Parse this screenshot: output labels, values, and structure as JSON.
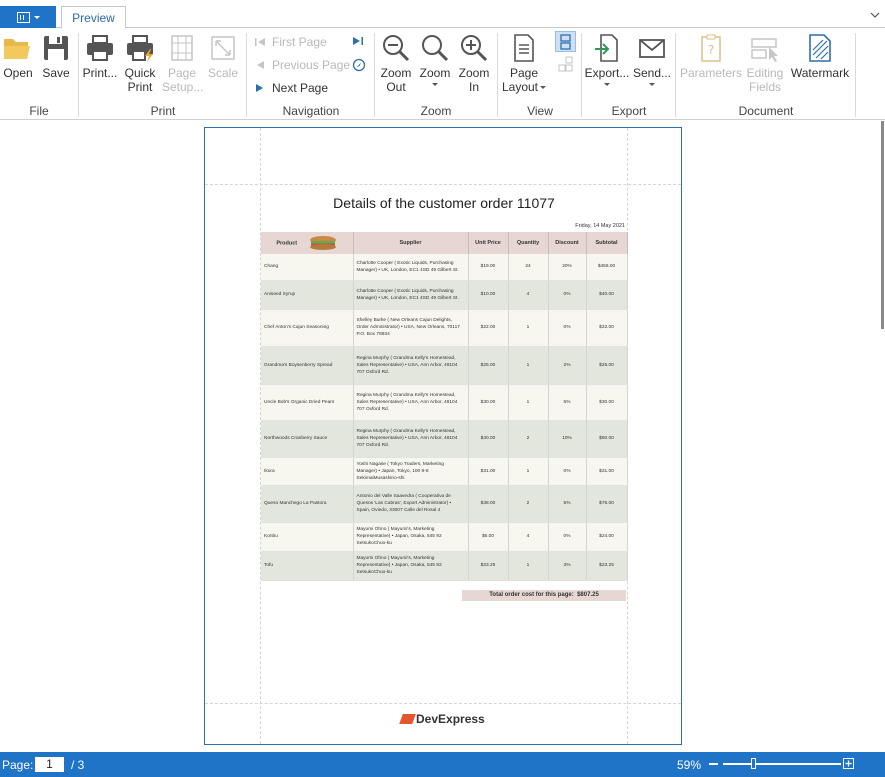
{
  "tabs": {
    "active": "Preview"
  },
  "colors": {
    "accent": "#1f74c7",
    "header_row": "#e6d7d3",
    "row_light": "#f7f7f0",
    "row_dark": "#e2e6dc"
  },
  "ribbon": {
    "groups": {
      "file": "File",
      "print": "Print",
      "navigation": "Navigation",
      "zoom": "Zoom",
      "view": "View",
      "export": "Export",
      "document": "Document"
    },
    "buttons": {
      "open": "Open",
      "save": "Save",
      "print": "Print...",
      "quick_print_1": "Quick",
      "quick_print_2": "Print",
      "page_setup_1": "Page",
      "page_setup_2": "Setup...",
      "scale": "Scale",
      "first_page": "First Page",
      "previous_page": "Previous Page",
      "next_page": "Next Page",
      "zoom_out_1": "Zoom",
      "zoom_out_2": "Out",
      "zoom": "Zoom",
      "zoom_in_1": "Zoom",
      "zoom_in_2": "In",
      "page_layout_1": "Page",
      "page_layout_2": "Layout",
      "export": "Export...",
      "send": "Send...",
      "parameters": "Parameters",
      "editing_fields_1": "Editing",
      "editing_fields_2": "Fields",
      "watermark": "Watermark"
    }
  },
  "report": {
    "title": "Details of the customer order",
    "order_number": "11077",
    "date": "Friday, 14 May 2021",
    "columns": [
      "Product",
      "Supplier",
      "Unit Price",
      "Quantity",
      "Discount",
      "Subtotal"
    ],
    "rows": [
      [
        "Chang",
        "Charlotte Cooper ( Exotic Liquids, Purchasing Manager) • UK, London, EC1 4SD 49 Gilbert St.",
        "$19.00",
        "24",
        "20%",
        "$456.00"
      ],
      [
        "Aniseed Syrup",
        "Charlotte Cooper ( Exotic Liquids, Purchasing Manager) • UK, London, EC1 4SD 49 Gilbert St.",
        "$10.00",
        "4",
        "0%",
        "$40.00"
      ],
      [
        "Chef Anton's Cajun Seasoning",
        "Shelley Burke ( New Orleans Cajun Delights, Order Administrator) • USA, New Orleans, 70117 P.O. Box 78934",
        "$22.00",
        "1",
        "0%",
        "$22.00"
      ],
      [
        "Grandma's Boysenberry Spread",
        "Regina Murphy ( Grandma Kelly's Homestead, Sales Representative) • USA, Ann Arbor, 48104 707 Oxford Rd.",
        "$25.00",
        "1",
        "2%",
        "$25.00"
      ],
      [
        "Uncle Bob's Organic Dried Pears",
        "Regina Murphy ( Grandma Kelly's Homestead, Sales Representative) • USA, Ann Arbor, 48104 707 Oxford Rd.",
        "$30.00",
        "1",
        "5%",
        "$30.00"
      ],
      [
        "Northwoods Cranberry Sauce",
        "Regina Murphy ( Grandma Kelly's Homestead, Sales Representative) • USA, Ann Arbor, 48104 707 Oxford Rd.",
        "$40.00",
        "2",
        "10%",
        "$80.00"
      ],
      [
        "Ikura",
        "Yoshi Nagase ( Tokyo Traders, Marketing Manager) • Japan, Tokyo, 100 9-8 SekimaiMusashino-shi",
        "$31.00",
        "1",
        "0%",
        "$31.00"
      ],
      [
        "Queso Manchego La Pastora",
        "Antonio del Valle Saavedra ( Cooperativa de Quesos 'Las Cabras', Export Administrator) • Spain, Oviedo, 33007 Calle del Rosal 4",
        "$38.00",
        "2",
        "5%",
        "$76.00"
      ],
      [
        "Konbu",
        "Mayumi Ohno ( Mayumi's, Marketing Representative) • Japan, Osaka, 545 92 SetsukoChuo-ku",
        "$6.00",
        "4",
        "0%",
        "$24.00"
      ],
      [
        "Tofu",
        "Mayumi Ohno ( Mayumi's, Marketing Representative) • Japan, Osaka, 545 92 SetsukoChuo-ku",
        "$23.25",
        "1",
        "3%",
        "$23.25"
      ]
    ],
    "total_label": "Total order cost for this page:",
    "total_value": "$807.25",
    "logo_text": "DevExpress"
  },
  "status": {
    "page_label": "Page:",
    "page_value": "1",
    "page_total": "/ 3",
    "zoom": "59%"
  },
  "icons": [
    "app-menu-icon",
    "open-folder-icon",
    "save-disk-icon",
    "printer-icon",
    "quick-print-icon",
    "page-setup-icon",
    "scale-icon",
    "first-page-icon",
    "previous-page-icon",
    "next-page-icon",
    "last-page-icon",
    "find-icon",
    "zoom-out-icon",
    "zoom-icon",
    "zoom-in-icon",
    "page-layout-icon",
    "multi-page-icon",
    "export-icon",
    "send-envelope-icon",
    "parameters-icon",
    "editing-fields-icon",
    "watermark-icon",
    "sandwich-image"
  ]
}
